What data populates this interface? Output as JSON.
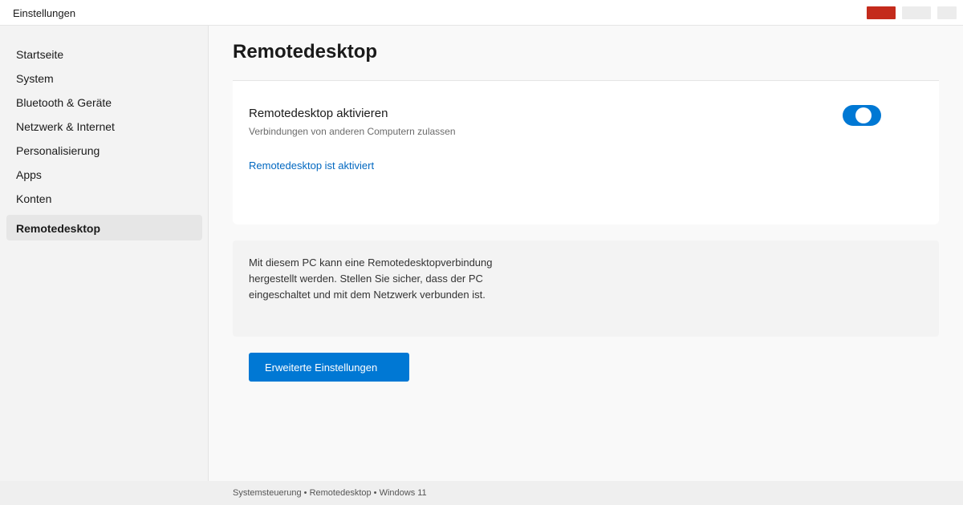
{
  "window": {
    "title": "Einstellungen",
    "controls": [
      "close",
      "maximize",
      "minimize"
    ],
    "close_color": "#c42b1c"
  },
  "sidebar": {
    "items": [
      {
        "label": "Startseite"
      },
      {
        "label": "System"
      },
      {
        "label": "Bluetooth & Geräte"
      },
      {
        "label": "Netzwerk & Internet"
      },
      {
        "label": "Personalisierung"
      },
      {
        "label": "Apps"
      },
      {
        "label": "Konten"
      },
      {
        "label": "Remotedesktop",
        "selected": true
      }
    ]
  },
  "main": {
    "page_title": "Remotedesktop",
    "setting": {
      "title": "Remotedesktop aktivieren",
      "subtitle": "Verbindungen von anderen Computern zulassen",
      "toggle_on": true,
      "status_text": "Remotedesktop ist aktiviert"
    },
    "info": {
      "lines": [
        "Mit diesem PC kann eine Remotedesktopverbindung",
        "hergestellt werden. Stellen Sie sicher, dass der PC",
        "eingeschaltet und mit dem Netzwerk verbunden ist."
      ]
    },
    "advanced_button_label": "Erweiterte Einstellungen"
  },
  "footer": {
    "text": "Systemsteuerung • Remotedesktop • Windows 11"
  },
  "colors": {
    "accent": "#0078d4",
    "link": "#0067c0"
  }
}
